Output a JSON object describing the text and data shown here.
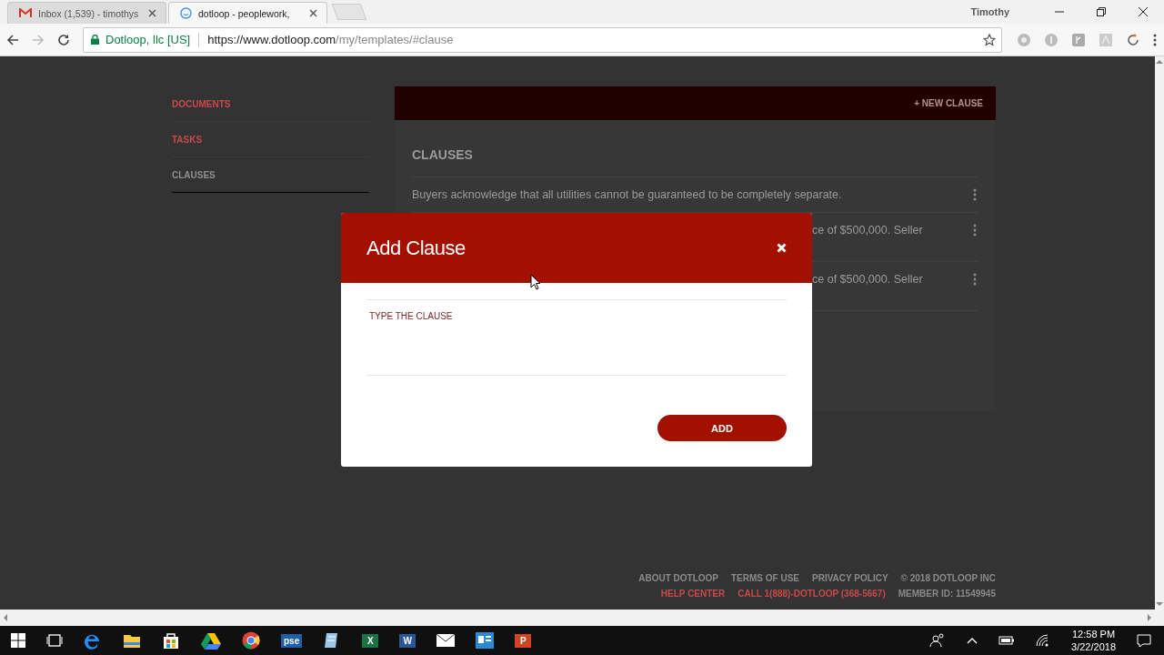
{
  "browser": {
    "tabs": [
      {
        "kind": "mail",
        "title": "Inbox (1,539) - timothys",
        "selected": false
      },
      {
        "kind": "site",
        "title": "dotloop - peoplework,",
        "selected": true
      }
    ],
    "profile": "Timothy",
    "site_identity": "Dotloop, llc [US]",
    "url": {
      "host": "https://www.dotloop.com",
      "path": "/my/templates/#clause"
    }
  },
  "sidebar": {
    "items": [
      {
        "label": "DOCUMENTS",
        "selected": false
      },
      {
        "label": "TASKS",
        "selected": false
      },
      {
        "label": "CLAUSES",
        "selected": true
      }
    ]
  },
  "header": {
    "new_clause": "+ NEW CLAUSE"
  },
  "clauses": {
    "title": "CLAUSES",
    "rows": [
      {
        "kind": "full",
        "text": "Buyers acknowledge that all utilities cannot be guaranteed to be completely separate."
      },
      {
        "kind": "covered",
        "text": "ce of $500,000. Seller"
      },
      {
        "kind": "covered",
        "text": "ce of $500,000. Seller"
      }
    ]
  },
  "footer": {
    "top": [
      {
        "kind": "plain",
        "text": "ABOUT DOTLOOP"
      },
      {
        "kind": "plain",
        "text": "TERMS OF USE"
      },
      {
        "kind": "plain",
        "text": "PRIVACY POLICY"
      },
      {
        "kind": "plain",
        "text": "© 2018 DOTLOOP INC"
      }
    ],
    "bottom": [
      {
        "kind": "link",
        "text": "HELP CENTER"
      },
      {
        "kind": "link",
        "text": "CALL 1(888)-DOTLOOP (368-5667)"
      },
      {
        "kind": "plain",
        "text": "MEMBER ID: 11549945"
      }
    ]
  },
  "dialog": {
    "title": "Add Clause",
    "field": {
      "placeholder": "TYPE THE CLAUSE"
    },
    "button": "ADD"
  },
  "taskbar": {
    "apps": [
      {
        "kind": "taskview"
      },
      {
        "kind": "edge"
      },
      {
        "kind": "folder"
      },
      {
        "kind": "store"
      },
      {
        "kind": "drive"
      },
      {
        "kind": "chrome"
      },
      {
        "kind": "letter",
        "letter": "pse",
        "color": "#1f5fa8"
      },
      {
        "kind": "notepad"
      },
      {
        "kind": "letter",
        "letter": "X",
        "color": "#1e7145"
      },
      {
        "kind": "letter",
        "letter": "W",
        "color": "#2b5797"
      },
      {
        "kind": "mail"
      },
      {
        "kind": "outlook"
      },
      {
        "kind": "letter",
        "letter": "P",
        "color": "#d04423"
      }
    ],
    "time": "12:58 PM",
    "date": "3/22/2018"
  }
}
